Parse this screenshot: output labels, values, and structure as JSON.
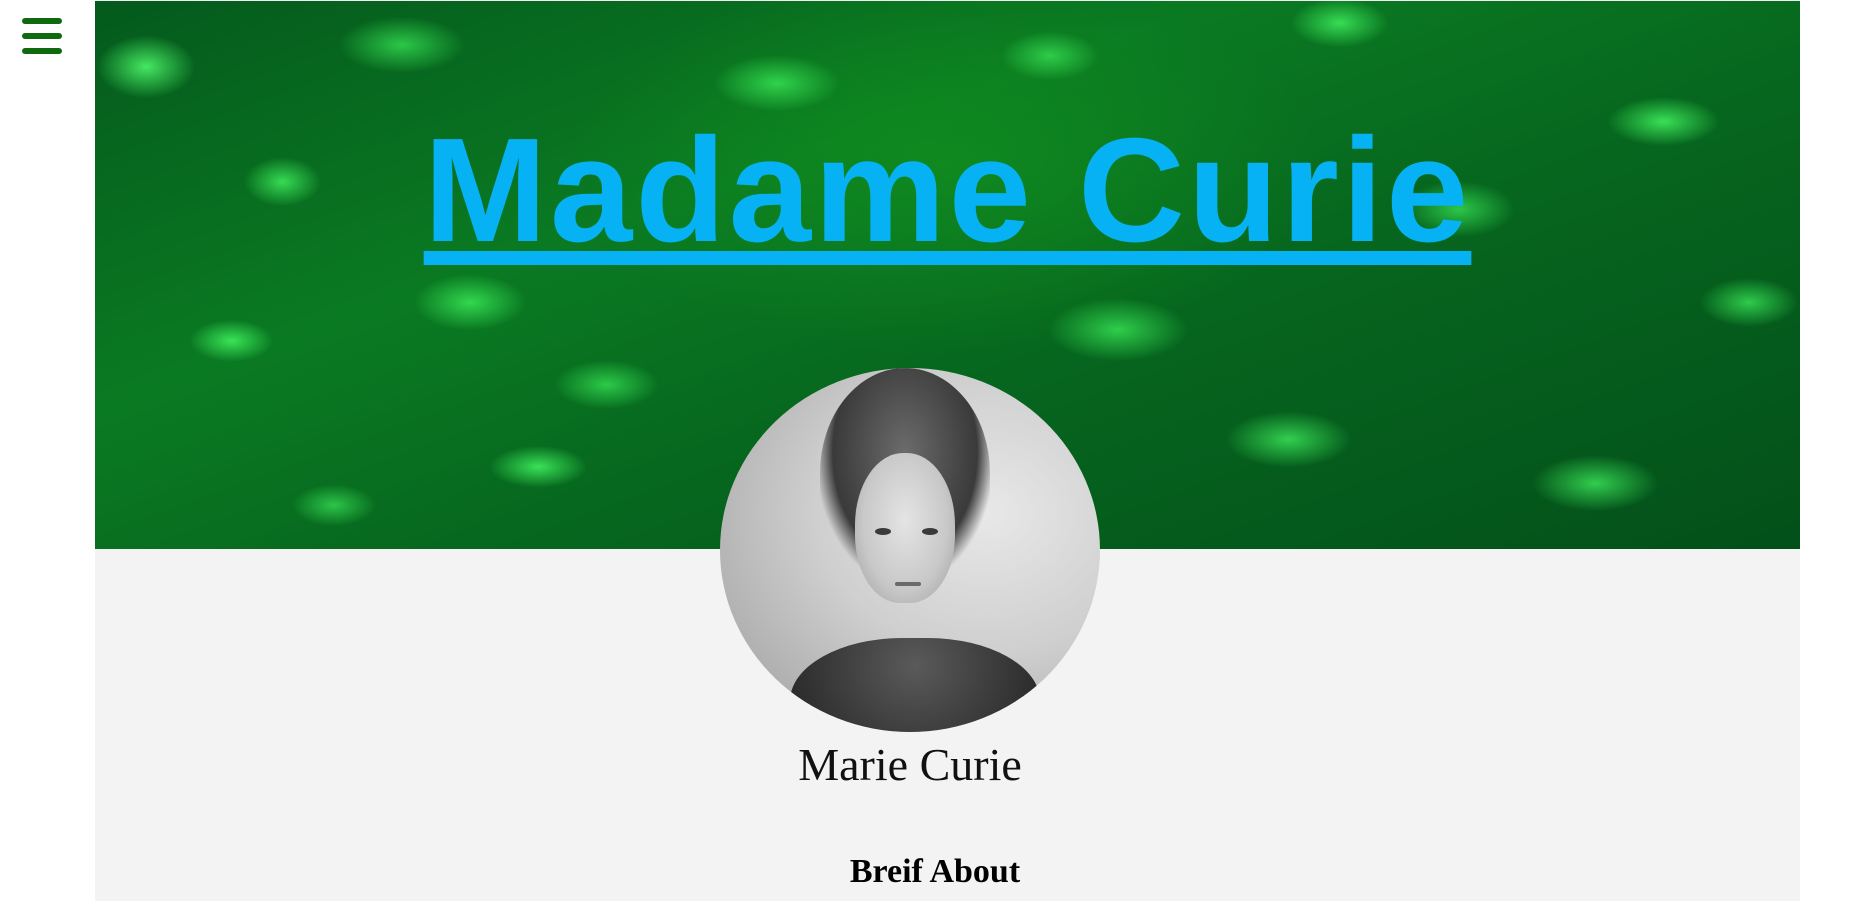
{
  "nav": {
    "menu_icon": "hamburger-menu-icon",
    "menu_color": "#0f6a0f"
  },
  "hero": {
    "title": "Madame Curie",
    "title_color": "#06b2f4"
  },
  "profile": {
    "image_alt": "Portrait photograph of Marie Curie",
    "name": "Marie Curie"
  },
  "sections": {
    "about_heading": "Breif About"
  }
}
